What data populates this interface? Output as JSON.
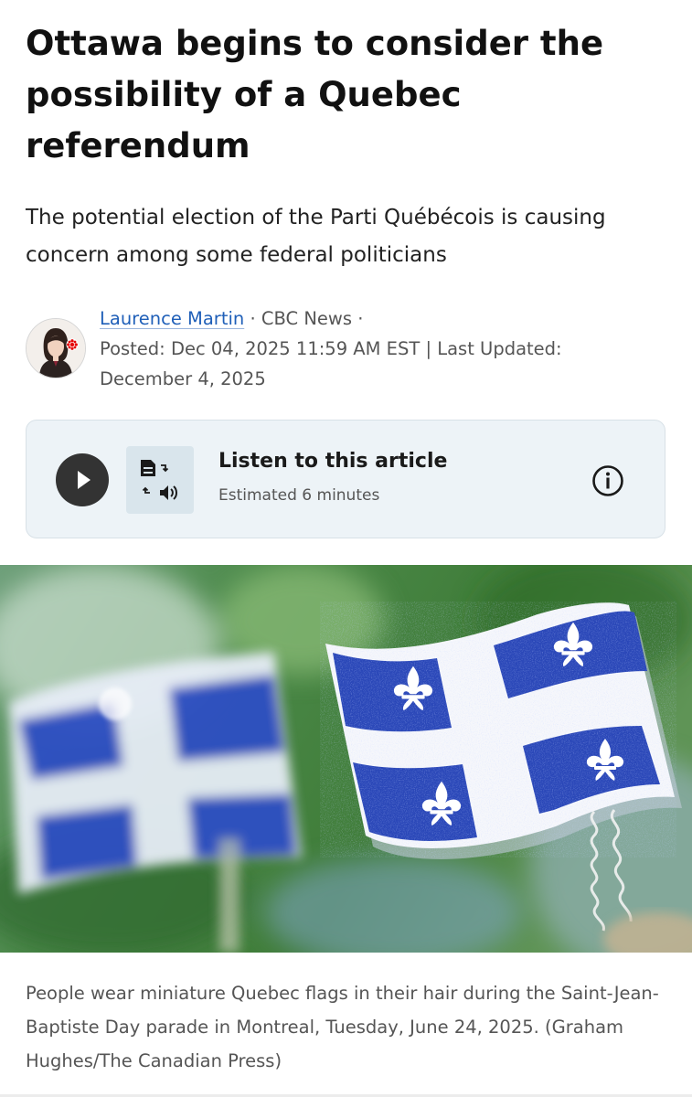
{
  "article": {
    "headline": "Ottawa begins to consider the possibility of a Quebec referendum",
    "dek": "The potential election of the Parti Québécois is causing concern among some federal politicians"
  },
  "byline": {
    "author": "Laurence Martin",
    "sep1": " · ",
    "outlet": "CBC News",
    "sep2": " ·",
    "posted": "Posted: Dec 04, 2025 11:59 AM EST | Last Updated: December 4, 2025"
  },
  "listen": {
    "title": "Listen to this article",
    "subtitle": "Estimated 6 minutes",
    "icons": {
      "play": "play-icon",
      "doc": "text-to-speech-icon",
      "info": "info-icon"
    }
  },
  "photo": {
    "subject": "miniature Quebec flags",
    "caption": "People wear miniature Quebec flags in their hair during the Saint-Jean-Baptiste Day parade in Montreal, Tuesday, June 24, 2025. (Graham Hughes/The Canadian Press)"
  },
  "colors": {
    "link": "#1f5fb8",
    "panel_bg": "#edf3f7",
    "flag_blue": "#2a47b8",
    "cbc_red": "#e60505"
  }
}
